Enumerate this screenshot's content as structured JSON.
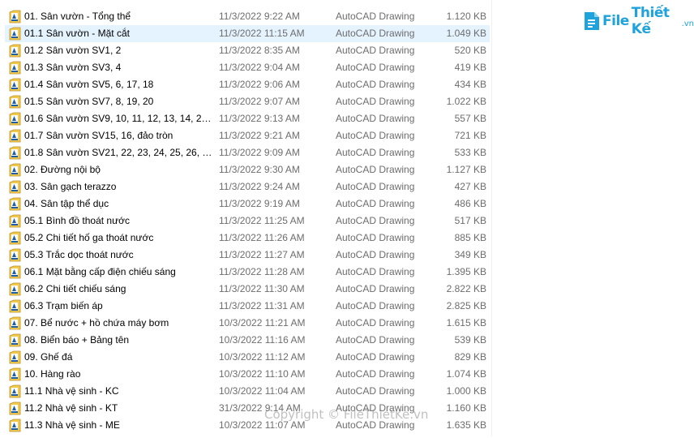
{
  "brand": {
    "part1": "File",
    "part2": "Thiết Kế",
    "part3": ".vn"
  },
  "watermark": "Copyright © FileThietKe.vn",
  "files": [
    {
      "name": "01. Sân vườn - Tổng thể",
      "date": "11/3/2022 9:22 AM",
      "type": "AutoCAD Drawing",
      "size": "1.120 KB"
    },
    {
      "name": "01.1 Sân vườn - Mặt cắt",
      "date": "11/3/2022 11:15 AM",
      "type": "AutoCAD Drawing",
      "size": "1.049 KB",
      "selected": true
    },
    {
      "name": "01.2 Sân vườn SV1, 2",
      "date": "11/3/2022 8:35 AM",
      "type": "AutoCAD Drawing",
      "size": "520 KB"
    },
    {
      "name": "01.3 Sân vườn SV3, 4",
      "date": "11/3/2022 9:04 AM",
      "type": "AutoCAD Drawing",
      "size": "419 KB"
    },
    {
      "name": "01.4 Sân vườn SV5, 6, 17, 18",
      "date": "11/3/2022 9:06 AM",
      "type": "AutoCAD Drawing",
      "size": "434 KB"
    },
    {
      "name": "01.5 Sân vườn SV7, 8, 19, 20",
      "date": "11/3/2022 9:07 AM",
      "type": "AutoCAD Drawing",
      "size": "1.022 KB"
    },
    {
      "name": "01.6 Sân vườn SV9, 10, 11, 12, 13, 14, 29, 3...",
      "date": "11/3/2022 9:13 AM",
      "type": "AutoCAD Drawing",
      "size": "557 KB"
    },
    {
      "name": "01.7 Sân vườn SV15, 16, đảo tròn",
      "date": "11/3/2022 9:21 AM",
      "type": "AutoCAD Drawing",
      "size": "721 KB"
    },
    {
      "name": "01.8 Sân vườn SV21, 22, 23, 24, 25, 26, 27, ...",
      "date": "11/3/2022 9:09 AM",
      "type": "AutoCAD Drawing",
      "size": "533 KB"
    },
    {
      "name": "02. Đường nội bộ",
      "date": "11/3/2022 9:30 AM",
      "type": "AutoCAD Drawing",
      "size": "1.127 KB"
    },
    {
      "name": "03. Sân gạch terazzo",
      "date": "11/3/2022 9:24 AM",
      "type": "AutoCAD Drawing",
      "size": "427 KB"
    },
    {
      "name": "04. Sân tập thể dục",
      "date": "11/3/2022 9:19 AM",
      "type": "AutoCAD Drawing",
      "size": "486 KB"
    },
    {
      "name": "05.1 Bình đồ thoát nước",
      "date": "11/3/2022 11:25 AM",
      "type": "AutoCAD Drawing",
      "size": "517 KB"
    },
    {
      "name": "05.2 Chi tiết hố ga thoát nước",
      "date": "11/3/2022 11:26 AM",
      "type": "AutoCAD Drawing",
      "size": "885 KB"
    },
    {
      "name": "05.3 Trắc dọc thoát nước",
      "date": "11/3/2022 11:27 AM",
      "type": "AutoCAD Drawing",
      "size": "349 KB"
    },
    {
      "name": "06.1 Mặt bằng cấp điện chiếu sáng",
      "date": "11/3/2022 11:28 AM",
      "type": "AutoCAD Drawing",
      "size": "1.395 KB"
    },
    {
      "name": "06.2 Chi tiết chiếu sáng",
      "date": "11/3/2022 11:30 AM",
      "type": "AutoCAD Drawing",
      "size": "2.822 KB"
    },
    {
      "name": "06.3 Trạm biến áp",
      "date": "11/3/2022 11:31 AM",
      "type": "AutoCAD Drawing",
      "size": "2.825 KB"
    },
    {
      "name": "07. Bể nước + hồ chứa máy bơm",
      "date": "10/3/2022 11:21 AM",
      "type": "AutoCAD Drawing",
      "size": "1.615 KB"
    },
    {
      "name": "08. Biển báo + Bảng tên",
      "date": "10/3/2022 11:16 AM",
      "type": "AutoCAD Drawing",
      "size": "539 KB"
    },
    {
      "name": "09. Ghế đá",
      "date": "10/3/2022 11:12 AM",
      "type": "AutoCAD Drawing",
      "size": "829 KB"
    },
    {
      "name": "10. Hàng rào",
      "date": "10/3/2022 11:10 AM",
      "type": "AutoCAD Drawing",
      "size": "1.074 KB"
    },
    {
      "name": "11.1 Nhà vệ sinh - KC",
      "date": "10/3/2022 11:04 AM",
      "type": "AutoCAD Drawing",
      "size": "1.000 KB"
    },
    {
      "name": "11.2 Nhà vệ sinh - KT",
      "date": "31/3/2022 9:14 AM",
      "type": "AutoCAD Drawing",
      "size": "1.160 KB"
    },
    {
      "name": "11.3 Nhà vệ sinh - ME",
      "date": "10/3/2022 11:07 AM",
      "type": "AutoCAD Drawing",
      "size": "1.635 KB"
    }
  ],
  "colors": {
    "selected_row": "#e5f3ff",
    "secondary_text": "#6d6d6d",
    "brand": "#1fa3dd"
  }
}
